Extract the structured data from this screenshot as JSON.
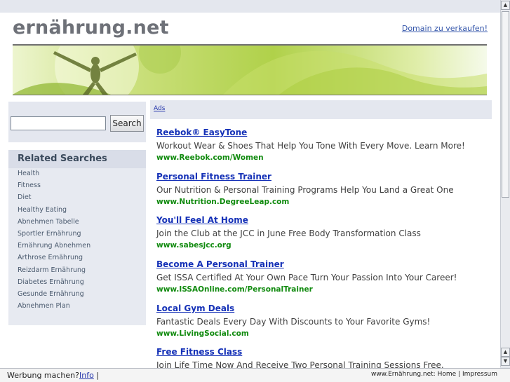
{
  "header": {
    "site_title": "ernährung.net",
    "domain_sale_link": "Domain zu verkaufen!"
  },
  "search": {
    "input_value": "",
    "button_label": "Search"
  },
  "related": {
    "title": "Related Searches",
    "items": [
      "Health",
      "Fitness",
      "Diet",
      "Healthy Eating",
      "Abnehmen Tabelle",
      "Sportler Ernährung",
      "Ernährung Abnehmen",
      "Arthrose Ernährung",
      "Reizdarm Ernährung",
      "Diabetes Ernährung",
      "Gesunde Ernährung",
      "Abnehmen Plan"
    ]
  },
  "ads": {
    "label": "Ads",
    "items": [
      {
        "title": "Reebok® EasyTone",
        "desc": "Workout Wear & Shoes That Help You Tone With Every Move. Learn More!",
        "url": "www.Reebok.com/Women"
      },
      {
        "title": "Personal Fitness Trainer",
        "desc": "Our Nutrition & Personal Training Programs Help You Land a Great One",
        "url": "www.Nutrition.DegreeLeap.com"
      },
      {
        "title": "You'll Feel At Home",
        "desc": "Join the Club at the JCC in June Free Body Transformation Class",
        "url": "www.sabesjcc.org"
      },
      {
        "title": "Become A Personal Trainer",
        "desc": "Get ISSA Certified At Your Own Pace Turn Your Passion Into Your Career!",
        "url": "www.ISSAOnline.com/PersonalTrainer"
      },
      {
        "title": "Local Gym Deals",
        "desc": "Fantastic Deals Every Day With Discounts to Your Favorite Gyms!",
        "url": "www.LivingSocial.com"
      },
      {
        "title": "Free Fitness Class",
        "desc": "Join Life Time Now And Receive Two Personal Training Sessions Free.",
        "url": ""
      }
    ]
  },
  "bottom_bar": {
    "werbung_text": "Werbung machen?",
    "info_link": "Info",
    "separator": "|",
    "site_label": "www.Ernährung.net:",
    "home": "Home",
    "divider": "|",
    "impressum": "Impressum"
  },
  "icons": {
    "scroll_up": "scroll-up-arrow-icon",
    "scroll_down": "scroll-down-arrow-icon"
  },
  "colors": {
    "ad_title": "#1531b7",
    "ad_url": "#108a0e",
    "panel_bg": "#e4e7ef"
  }
}
